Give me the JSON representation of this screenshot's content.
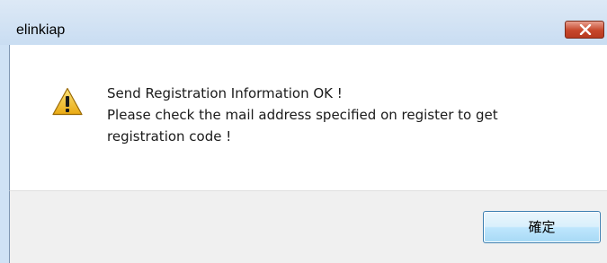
{
  "window": {
    "title": "elinkiap",
    "close_icon": "close-icon"
  },
  "message": {
    "icon": "warning-icon",
    "lines": [
      "Send Registration Information OK !",
      "Please check the mail address specified on register to get",
      "registration code !"
    ]
  },
  "buttons": {
    "ok_label": "確定"
  },
  "colors": {
    "title_bar": "#c9ddf2",
    "close_button": "#c6462b",
    "footer": "#f0f0f0",
    "button_border": "#3c7fb1",
    "warning_fill": "#f2c230"
  }
}
